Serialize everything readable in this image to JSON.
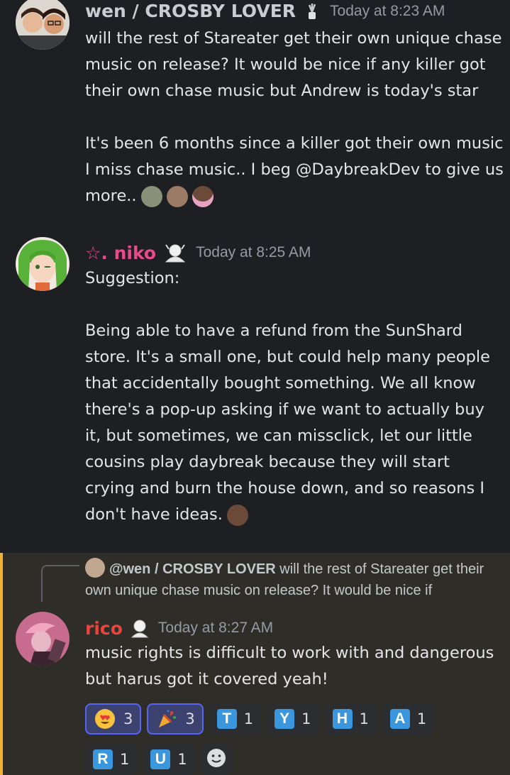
{
  "messages": [
    {
      "username": "wen / CROSBY LOVER",
      "username_color": "#c9ccd1",
      "timestamp": "Today at 8:23 AM",
      "paragraphs": [
        "will the rest of Stareater get their own unique chase music on release? It would be nice if any killer got their own chase music but Andrew is today's star",
        "It's been 6 months since a killer got their own music I miss chase music.. I beg @DaybreakDev to give us more.."
      ]
    },
    {
      "username": "☆. niko",
      "username_color": "#e84a8a",
      "timestamp": "Today at 8:25 AM",
      "paragraphs": [
        "Suggestion:",
        "Being able to have a refund from the SunShard store. It's a small one, but could help many people that accidentally bought something. We all know there's a pop-up asking if we want to actually buy it, but sometimes, we can missclick, let our little cousins play daybreak because they will start crying and burn the house down, and so reasons I don't have ideas."
      ]
    },
    {
      "reply_to": {
        "username": "@wen / CROSBY LOVER",
        "preview": "will the rest of Stareater get their own unique chase music on release? It would be nice if"
      },
      "username": "rico",
      "username_color": "#e8453c",
      "timestamp": "Today at 8:27 AM",
      "paragraphs": [
        "music rights is difficult to work with and dangerous but harus got it covered yeah!"
      ],
      "reactions": [
        {
          "emoji": "heart-eyes-icon",
          "count": "3",
          "me": true
        },
        {
          "emoji": "party-popper-icon",
          "count": "3",
          "me": true
        },
        {
          "letter": "T",
          "count": "1"
        },
        {
          "letter": "Y",
          "count": "1"
        },
        {
          "letter": "H",
          "count": "1"
        },
        {
          "letter": "A",
          "count": "1"
        },
        {
          "letter": "R",
          "count": "1"
        },
        {
          "letter": "U",
          "count": "1"
        }
      ]
    }
  ],
  "colors": {
    "background": "#1e1f22",
    "mention_highlight": "#2f2d28",
    "mention_bar": "#f0b232",
    "reaction_selected": "#5865f2",
    "timestamp": "#949ba4"
  }
}
